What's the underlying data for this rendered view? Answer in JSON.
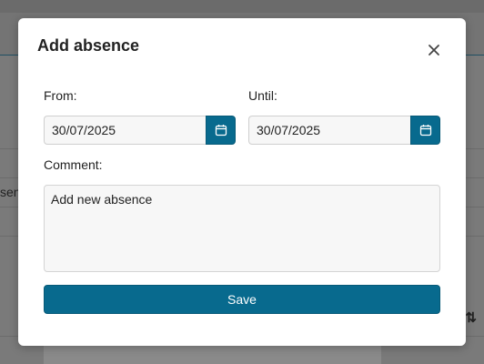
{
  "background": {
    "partial_text": "sen",
    "sort_glyph": "⇅"
  },
  "dialog": {
    "title": "Add absence",
    "close_icon": "close-icon",
    "from": {
      "label": "From:",
      "value": "30/07/2025",
      "icon": "calendar-icon"
    },
    "until": {
      "label": "Until:",
      "value": "30/07/2025",
      "icon": "calendar-icon"
    },
    "comment": {
      "label": "Comment:",
      "value": "Add new absence"
    },
    "save_label": "Save"
  },
  "colors": {
    "accent": "#086a8e",
    "overlay": "#7a7a7a"
  }
}
